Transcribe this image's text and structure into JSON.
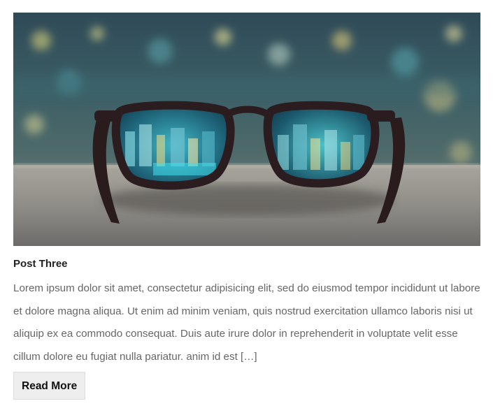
{
  "post": {
    "title": "Post Three",
    "excerpt": "Lorem ipsum dolor sit amet, consectetur adipisicing elit, sed do eiusmod tempor incididunt ut labore et dolore magna aliqua. Ut enim ad minim veniam, quis nostrud exercitation ullamco laboris nisi ut aliquip ex ea commodo consequat. Duis aute irure dolor in reprehenderit in voluptate velit esse cillum dolore eu fugiat nulla pariatur. anim id est […]",
    "read_more_label": "Read More"
  },
  "colors": {
    "title": "#222222",
    "excerpt": "#666666",
    "button_bg": "#eeeeee",
    "button_border": "#dddddd"
  }
}
